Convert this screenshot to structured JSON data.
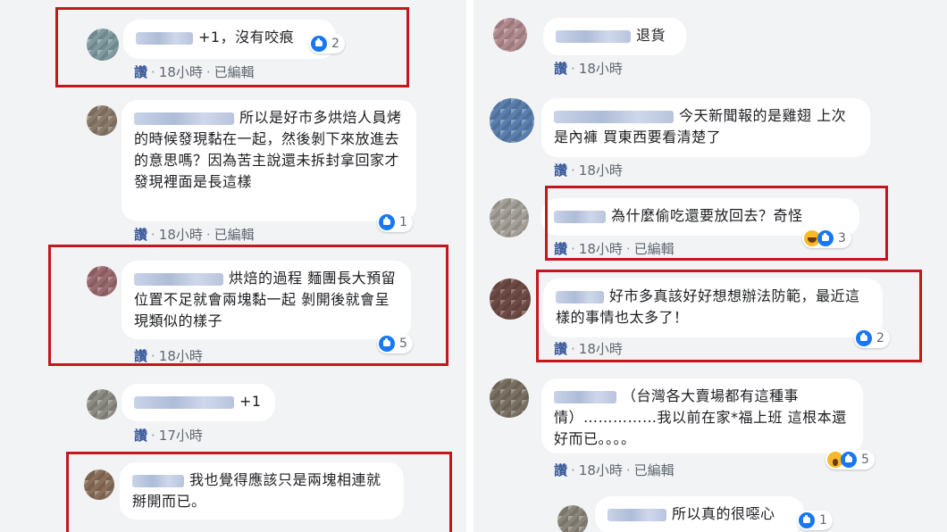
{
  "left": {
    "comments": [
      {
        "text": "+1，沒有咬痕",
        "like": "讚",
        "time": "18小時",
        "edited": "已編輯",
        "count": "2"
      },
      {
        "text": "所以是好市多烘焙人員烤的時候發現黏在一起，然後剝下來放進去的意思嗎？因為苦主說還未拆封拿回家才發現裡面是長這樣",
        "like": "讚",
        "time": "18小時",
        "edited": "已編輯",
        "count": "1"
      },
      {
        "text": "烘焙的過程 麵團長大預留位置不足就會兩塊黏一起 剝開後就會呈現類似的樣子",
        "like": "讚",
        "time": "18小時",
        "count": "5"
      },
      {
        "text": "+1",
        "like": "讚",
        "time": "17小時"
      },
      {
        "text": "我也覺得應該只是兩塊相連就掰開而已。"
      }
    ]
  },
  "right": {
    "comments": [
      {
        "text": "退貨",
        "like": "讚",
        "time": "18小時"
      },
      {
        "text": "今天新聞報的是雞翅 上次是內褲 買東西要看清楚了",
        "like": "讚",
        "time": "18小時"
      },
      {
        "text": "為什麼偷吃還要放回去？奇怪",
        "like": "讚",
        "time": "18小時",
        "edited": "已編輯",
        "count": "3"
      },
      {
        "text": "好市多真該好好想想辦法防範，最近這樣的事情也太多了！",
        "like": "讚",
        "time": "18小時",
        "count": "2"
      },
      {
        "text": "（台灣各大賣場都有這種事情）……………我以前在家*福上班 這根本還好而已。。。。",
        "like": "讚",
        "time": "18小時",
        "edited": "已編輯",
        "count": "5"
      },
      {
        "text": "所以真的很噁心",
        "count": "1"
      }
    ]
  },
  "colors": {
    "highlight": "#c4161c",
    "like_text": "#385898",
    "bg": "#f2f3f5"
  }
}
